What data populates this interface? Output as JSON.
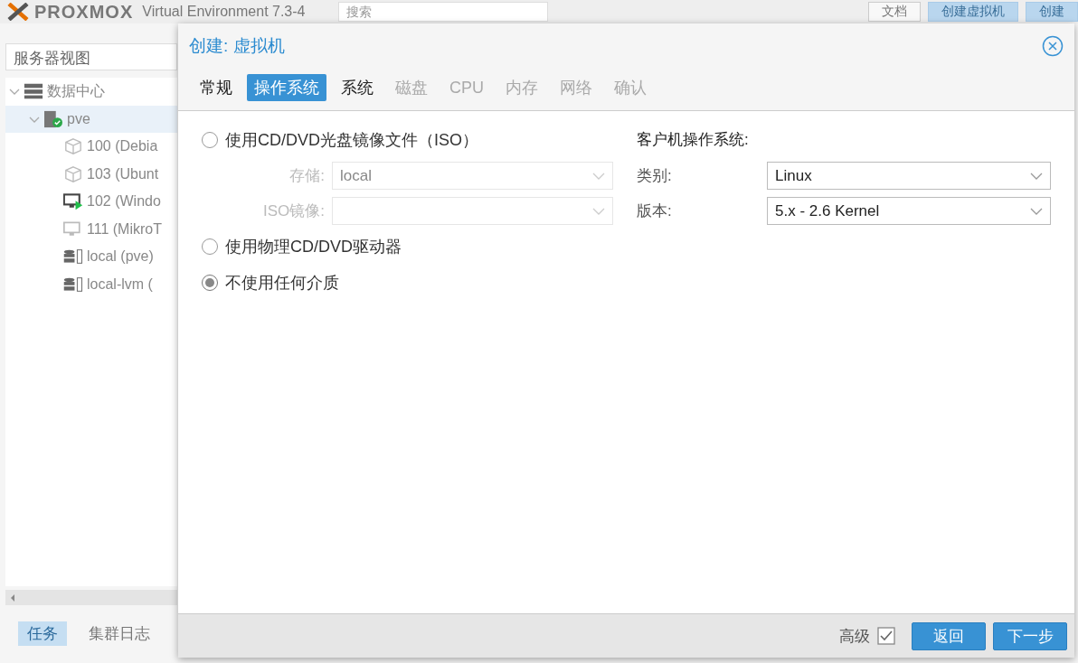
{
  "header": {
    "logo": "PROXMOX",
    "subtitle": "Virtual Environment 7.3-4",
    "search": {
      "placeholder": "搜索"
    },
    "buttons": [
      {
        "label": "文档",
        "kind": "plain"
      },
      {
        "label": "创建虚拟机",
        "kind": "primary"
      },
      {
        "label": "创建",
        "kind": "primary"
      }
    ]
  },
  "sidebar": {
    "view": "服务器视图",
    "tree": [
      {
        "label": "数据中心",
        "kind": "datacenter",
        "expanded": true,
        "selected": false,
        "children": [
          {
            "label": "pve",
            "kind": "node",
            "expanded": true,
            "selected": true,
            "children": [
              {
                "label": "100 (Debia",
                "kind": "container",
                "selected": false
              },
              {
                "label": "103 (Ubunt",
                "kind": "container",
                "selected": false
              },
              {
                "label": "102 (Windo",
                "kind": "vm-running",
                "selected": false
              },
              {
                "label": "111 (MikroT",
                "kind": "vm-stopped",
                "selected": false
              },
              {
                "label": "local (pve)",
                "kind": "storage",
                "selected": false
              },
              {
                "label": "local-lvm (",
                "kind": "storage",
                "selected": false
              }
            ]
          }
        ]
      }
    ]
  },
  "bottom_tabs": [
    {
      "label": "任务",
      "selected": true
    },
    {
      "label": "集群日志",
      "selected": false
    }
  ],
  "dialog": {
    "title": "创建: 虚拟机",
    "tabs": [
      {
        "label": "常规",
        "selected": false,
        "disabled": false
      },
      {
        "label": "操作系统",
        "selected": true,
        "disabled": false
      },
      {
        "label": "系统",
        "selected": false,
        "disabled": false
      },
      {
        "label": "磁盘",
        "selected": false,
        "disabled": true
      },
      {
        "label": "CPU",
        "selected": false,
        "disabled": true
      },
      {
        "label": "内存",
        "selected": false,
        "disabled": true
      },
      {
        "label": "网络",
        "selected": false,
        "disabled": true
      },
      {
        "label": "确认",
        "selected": false,
        "disabled": true
      }
    ],
    "media": [
      {
        "label": "使用CD/DVD光盘镜像文件（ISO）",
        "selected": false,
        "fields": [
          {
            "label": "存储:",
            "value": "local",
            "disabled": true
          },
          {
            "label": "ISO镜像:",
            "disabled": true
          }
        ]
      },
      {
        "label": "使用物理CD/DVD驱动器",
        "selected": false
      },
      {
        "label": "不使用任何介质",
        "selected": true
      }
    ],
    "guest_os": {
      "heading": "客户机操作系统:",
      "fields": [
        {
          "label": "类别:",
          "value": "Linux"
        },
        {
          "label": "版本:",
          "value": "5.x - 2.6 Kernel"
        }
      ]
    },
    "footer": {
      "advanced": {
        "label": "高级",
        "checked": true
      },
      "buttons": [
        "返回",
        "下一步"
      ]
    }
  }
}
